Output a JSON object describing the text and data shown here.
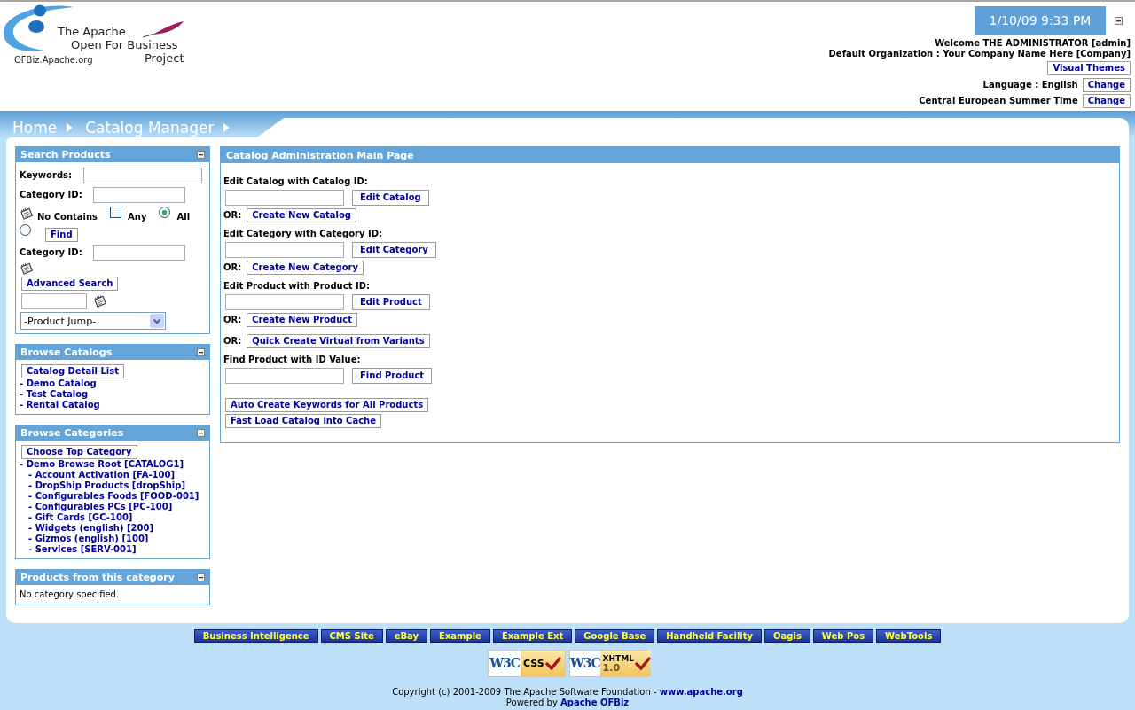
{
  "header": {
    "logo": {
      "lines": [
        "The Apache",
        "Open For Business",
        "Project"
      ],
      "url": "OFBiz.Apache.org"
    },
    "clock": "1/10/09 9:33 PM",
    "welcome": "Welcome THE ADMINISTRATOR [admin]",
    "organization": "Default Organization : Your Company Name Here [Company]",
    "visual_themes_button": "Visual Themes",
    "settings": [
      {
        "label": "Language : English",
        "button": "Change"
      },
      {
        "label": "Central European Summer Time",
        "button": "Change"
      }
    ]
  },
  "breadcrumbs": [
    {
      "label": "Home"
    },
    {
      "label": "Catalog Manager"
    }
  ],
  "sidebar": [
    {
      "kind": "search",
      "title": "Search Products",
      "keywords_label": "Keywords:",
      "category_label": "Category ID:",
      "options": [
        {
          "kind": "checkbox",
          "label": "No Contains",
          "checked": false
        },
        {
          "kind": "radio",
          "label": "Any",
          "selected": true
        },
        {
          "kind": "radio",
          "label": "All",
          "selected": false
        }
      ],
      "find_button": "Find",
      "second_category_label": "Category ID:",
      "advanced_search_button": "Advanced Search",
      "product_jump": "-Product Jump-"
    },
    {
      "kind": "links",
      "title": "Browse Catalogs",
      "button": "Catalog Detail List",
      "items": [
        "- Demo Catalog",
        "- Test Catalog",
        "- Rental Catalog"
      ]
    },
    {
      "kind": "tree",
      "title": "Browse Categories",
      "button": "Choose Top Category",
      "items": [
        {
          "label": "- Demo Browse Root [CATALOG1]",
          "children": [
            {
              "label": "- Account Activation [FA-100]"
            },
            {
              "label": "- DropShip Products [dropShip]"
            },
            {
              "label": "- Configurables Foods [FOOD-001]"
            },
            {
              "label": "- Configurables PCs [PC-100]"
            },
            {
              "label": "- Gift Cards [GC-100]"
            },
            {
              "label": "- Widgets (english) [200]"
            },
            {
              "label": "- Gizmos (english) [100]"
            },
            {
              "label": "- Services [SERV-001]"
            }
          ]
        }
      ]
    },
    {
      "kind": "text",
      "title": "Products from this category",
      "text": "No category specified."
    }
  ],
  "main": {
    "title": "Catalog Administration Main Page",
    "rows": [
      {
        "kind": "label",
        "text": "Edit Catalog with Catalog ID:"
      },
      {
        "kind": "input_button",
        "button": "Edit Catalog"
      },
      {
        "kind": "or_button",
        "prefix": "OR:",
        "button": "Create New Catalog"
      },
      {
        "kind": "label",
        "text": "Edit Category with Category ID:"
      },
      {
        "kind": "input_button",
        "button": "Edit Category"
      },
      {
        "kind": "or_button",
        "prefix": "OR:",
        "button": "Create New Category"
      },
      {
        "kind": "label",
        "text": "Edit Product with Product ID:"
      },
      {
        "kind": "input_button",
        "button": "Edit Product"
      },
      {
        "kind": "or_button",
        "prefix": "OR:",
        "button": "Create New Product"
      },
      {
        "kind": "or_button",
        "prefix": "OR:",
        "button": "Quick Create Virtual from Variants"
      },
      {
        "kind": "label",
        "text": "Find Product with ID Value:"
      },
      {
        "kind": "input_button",
        "button": "Find Product"
      },
      {
        "kind": "button",
        "button": "Auto Create Keywords for All Products"
      },
      {
        "kind": "button",
        "button": "Fast Load Catalog into Cache"
      }
    ]
  },
  "footer": {
    "apps": [
      "Business Intelligence",
      "CMS Site",
      "eBay",
      "Example",
      "Example Ext",
      "Google Base",
      "Handheld Facility",
      "Oagis",
      "Web Pos",
      "WebTools"
    ],
    "badges": [
      {
        "mark": "W3C",
        "label": "CSS"
      },
      {
        "mark": "W3C",
        "label": "XHTML",
        "version": "1.0"
      }
    ],
    "copyright": "Copyright (c) 2001-2009 The Apache Software Foundation -",
    "copyright_link": "www.apache.org",
    "powered_by": "Powered by",
    "powered_by_link": "Apache OFBiz"
  }
}
